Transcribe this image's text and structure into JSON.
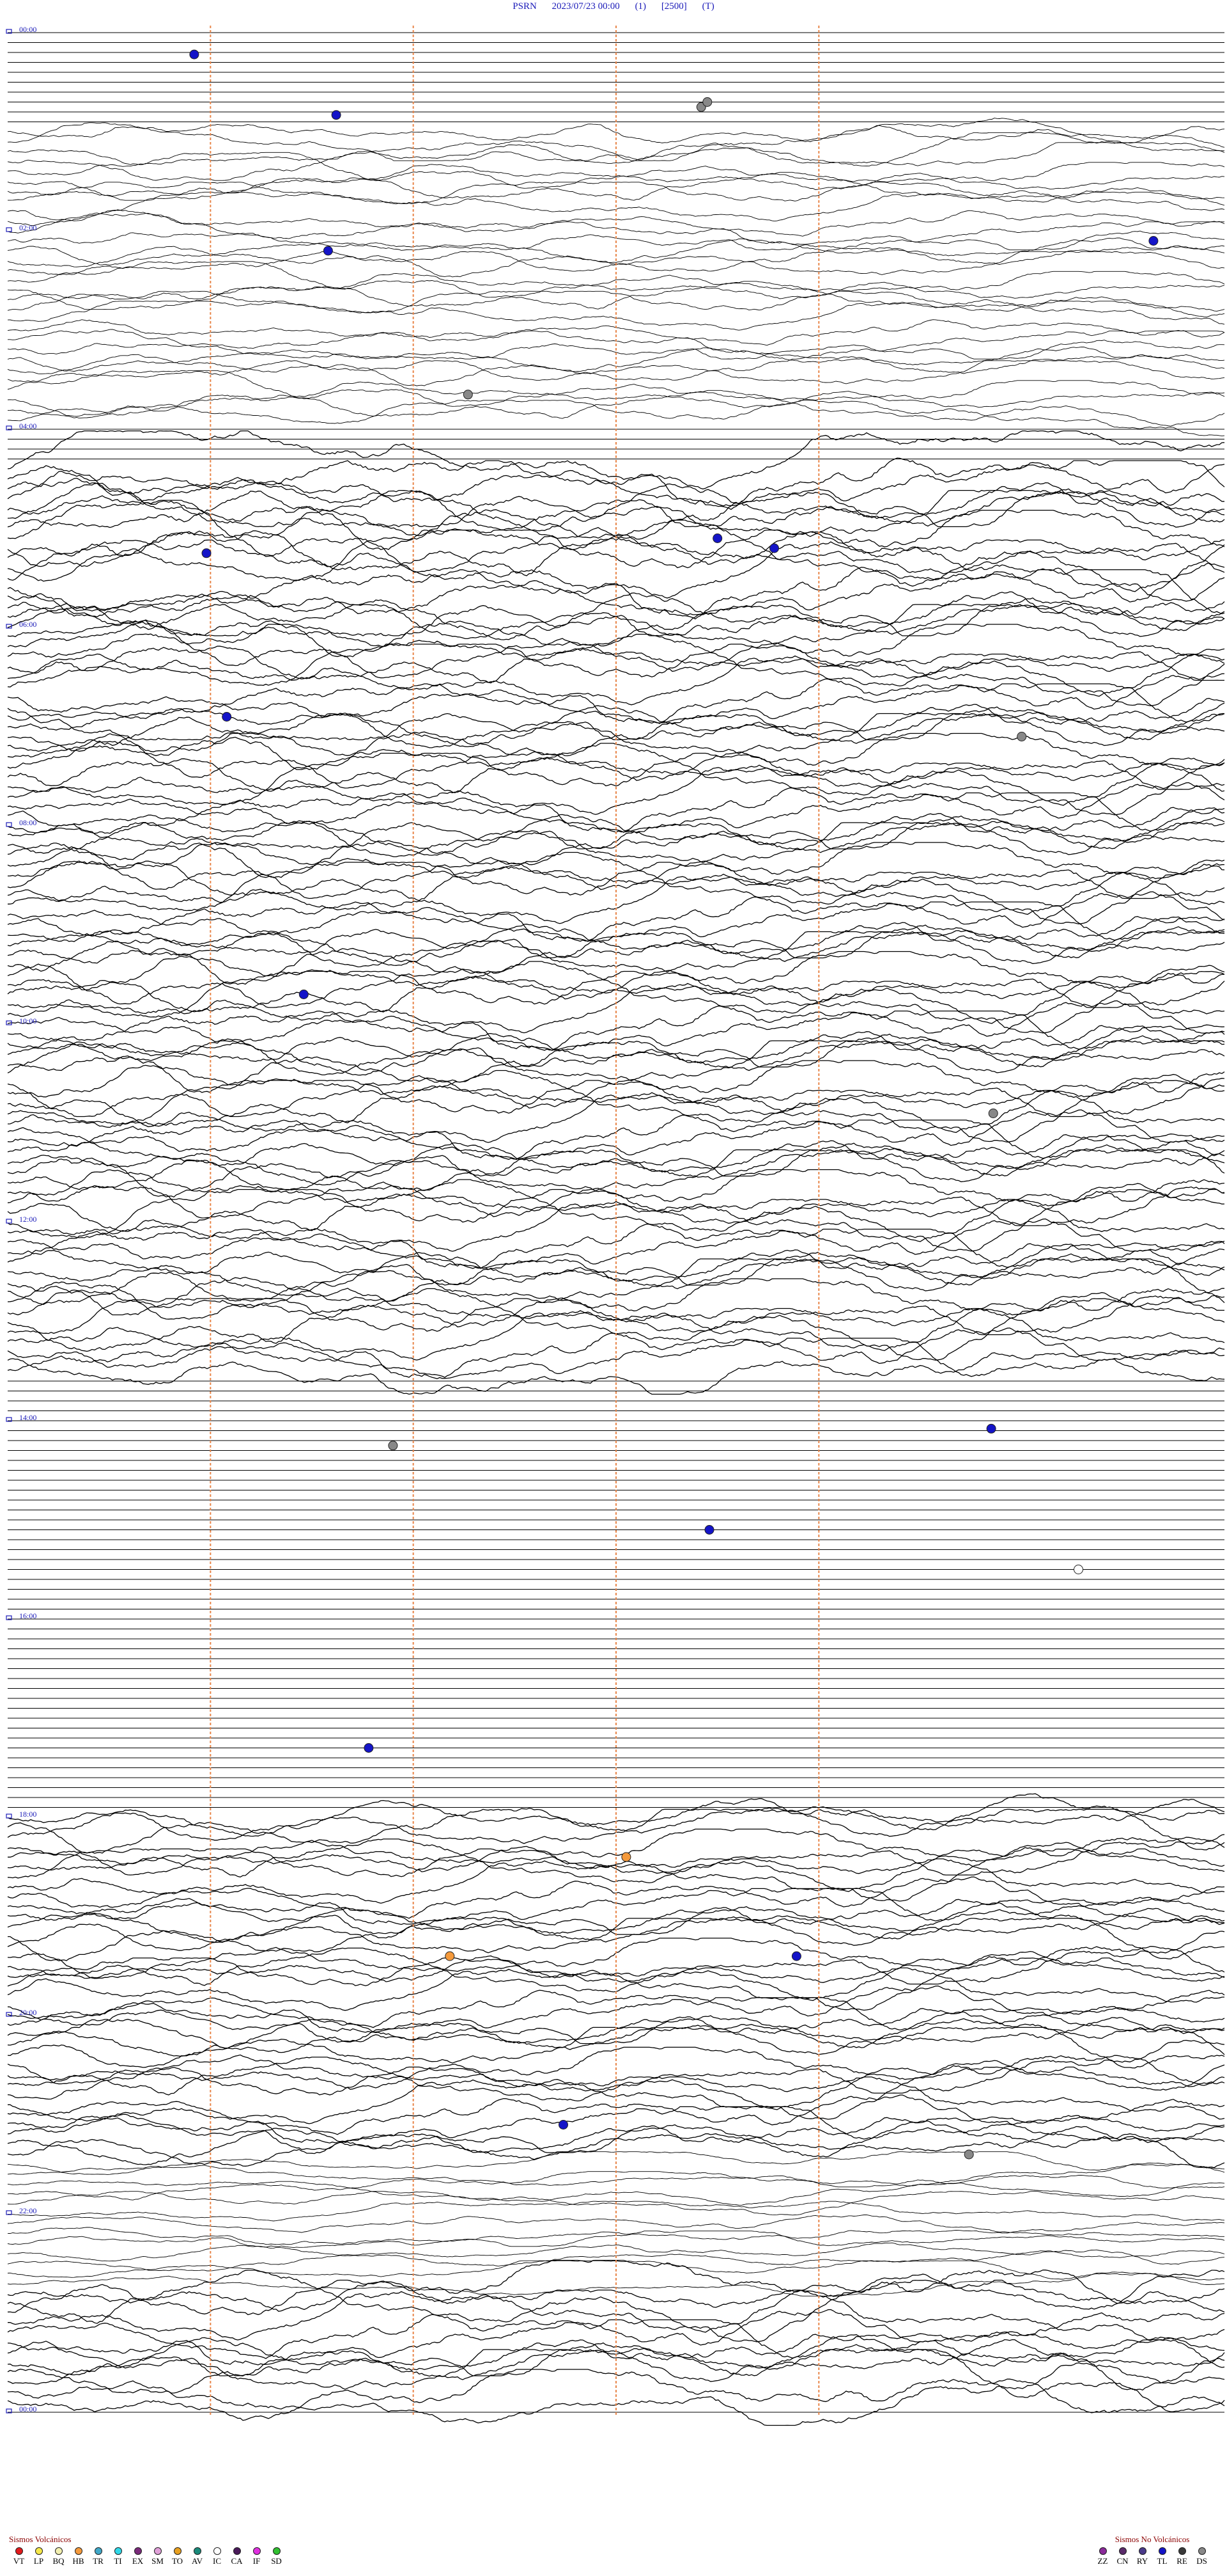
{
  "header": {
    "station": "PSRN",
    "datetime": "2023/07/23 00:00",
    "component": "(1)",
    "gain": "[2500]",
    "type": "(T)"
  },
  "chart_data": {
    "type": "line",
    "title": "PSRN 2023/07/23 00:00 (1) [2500] (T)",
    "hour_labels": [
      "00:00",
      "02:00",
      "04:00",
      "06:00",
      "08:00",
      "10:00",
      "12:00",
      "14:00",
      "16:00",
      "18:00",
      "20:00",
      "22:00",
      "00:00"
    ],
    "hour_label_rows": [
      0,
      20,
      40,
      60,
      80,
      100,
      120,
      140,
      160,
      180,
      200,
      220,
      240
    ],
    "minute_marks": [
      10,
      20,
      30,
      40
    ],
    "trace_rows": 241,
    "row_interval_minutes": 6,
    "activity_bands": [
      {
        "from_row": 10,
        "to_row": 40,
        "level": 1.5
      },
      {
        "from_row": 44,
        "to_row": 60,
        "level": 3.0
      },
      {
        "from_row": 60,
        "to_row": 136,
        "level": 2.6
      },
      {
        "from_row": 136,
        "to_row": 180,
        "level": 0.0
      },
      {
        "from_row": 180,
        "to_row": 215,
        "level": 2.2
      },
      {
        "from_row": 215,
        "to_row": 228,
        "level": 1.0
      },
      {
        "from_row": 228,
        "to_row": 240,
        "level": 2.6
      }
    ],
    "events": [
      {
        "row": 2.2,
        "minute": 9.2,
        "class": "TL"
      },
      {
        "row": 7.5,
        "minute": 34.2,
        "class": "DS"
      },
      {
        "row": 8.3,
        "minute": 16.2,
        "class": "TL"
      },
      {
        "row": 7.0,
        "minute": 34.5,
        "class": "DS"
      },
      {
        "row": 22.0,
        "minute": 15.8,
        "class": "TL"
      },
      {
        "row": 21.0,
        "minute": 56.5,
        "class": "TL"
      },
      {
        "row": 36.5,
        "minute": 22.7,
        "class": "DS"
      },
      {
        "row": 51.0,
        "minute": 35.0,
        "class": "TL"
      },
      {
        "row": 52.0,
        "minute": 37.8,
        "class": "TL"
      },
      {
        "row": 52.5,
        "minute": 9.8,
        "class": "TL"
      },
      {
        "row": 69.0,
        "minute": 10.8,
        "class": "TL"
      },
      {
        "row": 71.0,
        "minute": 50.0,
        "class": "DS"
      },
      {
        "row": 97.0,
        "minute": 14.6,
        "class": "TL"
      },
      {
        "row": 109.0,
        "minute": 48.6,
        "class": "DS"
      },
      {
        "row": 140.8,
        "minute": 48.5,
        "class": "TL"
      },
      {
        "row": 142.5,
        "minute": 19.0,
        "class": "DS"
      },
      {
        "row": 151.0,
        "minute": 34.6,
        "class": "TL"
      },
      {
        "row": 155.0,
        "minute": 52.8,
        "class": "IC"
      },
      {
        "row": 173.0,
        "minute": 17.8,
        "class": "TL"
      },
      {
        "row": 184.0,
        "minute": 30.5,
        "class": "HB"
      },
      {
        "row": 194.0,
        "minute": 21.8,
        "class": "HB"
      },
      {
        "row": 194.0,
        "minute": 38.9,
        "class": "TL"
      },
      {
        "row": 211.0,
        "minute": 27.4,
        "class": "TL"
      },
      {
        "row": 214.0,
        "minute": 47.4,
        "class": "DS"
      }
    ]
  },
  "legend_volcanic": {
    "title": "Sismos Volcánicos",
    "items": [
      {
        "code": "VT",
        "color": "#e31a1c"
      },
      {
        "code": "LP",
        "color": "#f6e84a"
      },
      {
        "code": "BQ",
        "color": "#f2efb0"
      },
      {
        "code": "HB",
        "color": "#f59a3c"
      },
      {
        "code": "TR",
        "color": "#40a8c8"
      },
      {
        "code": "TI",
        "color": "#30d8e8"
      },
      {
        "code": "EX",
        "color": "#7a2a7a"
      },
      {
        "code": "SM",
        "color": "#e0a0d8"
      },
      {
        "code": "TO",
        "color": "#e8a020"
      },
      {
        "code": "AV",
        "color": "#1a8a7a"
      },
      {
        "code": "IC",
        "color": "#ffffff"
      },
      {
        "code": "CA",
        "color": "#4a1a5a"
      },
      {
        "code": "IF",
        "color": "#e030e0"
      },
      {
        "code": "SD",
        "color": "#30c030"
      }
    ]
  },
  "legend_nonvolcanic": {
    "title": "Sismos No Volcánicos",
    "items": [
      {
        "code": "ZZ",
        "color": "#8a2a9a"
      },
      {
        "code": "CN",
        "color": "#5a2a6a"
      },
      {
        "code": "RY",
        "color": "#4a3a8a"
      },
      {
        "code": "TL",
        "color": "#1414c8"
      },
      {
        "code": "RE",
        "color": "#3a3a3a"
      },
      {
        "code": "DS",
        "color": "#888888"
      }
    ]
  },
  "colors": {
    "hour_label": "#1a1ab8",
    "minute_line": "#e8864a",
    "trace": "#000000"
  }
}
